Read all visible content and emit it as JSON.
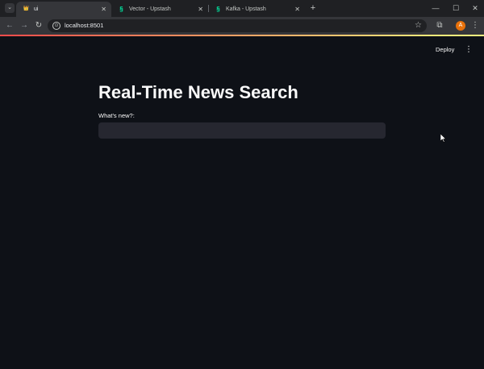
{
  "browser": {
    "tabs": [
      {
        "title": "ui",
        "active": true
      },
      {
        "title": "Vector - Upstash",
        "active": false
      },
      {
        "title": "Kafka - Upstash",
        "active": false
      }
    ],
    "tab_close_glyph": "✕",
    "new_tab_glyph": "+",
    "tab_menu_glyph": "⌄",
    "window_controls": {
      "minimize": "—",
      "maximize": "☐",
      "close": "✕"
    },
    "nav": {
      "back": "←",
      "forward": "→",
      "reload": "↻"
    },
    "address_bar": {
      "url": "localhost:8501"
    },
    "profile_initial": "A",
    "accent_colors": {
      "upstash": "#00e9a3",
      "profile": "#e8710a"
    }
  },
  "app": {
    "header": {
      "deploy_label": "Deploy",
      "menu_glyph": "⋮"
    },
    "title": "Real-Time News Search",
    "search": {
      "label": "What's new?:",
      "value": ""
    },
    "colors": {
      "background": "#0e1117",
      "input_bg": "#262730",
      "text": "#fafafa"
    }
  },
  "icons": {
    "site_info": "site-info-icon",
    "bookmark": "star-icon",
    "extensions": "puzzle-icon",
    "menu": "kebab-menu-icon"
  }
}
